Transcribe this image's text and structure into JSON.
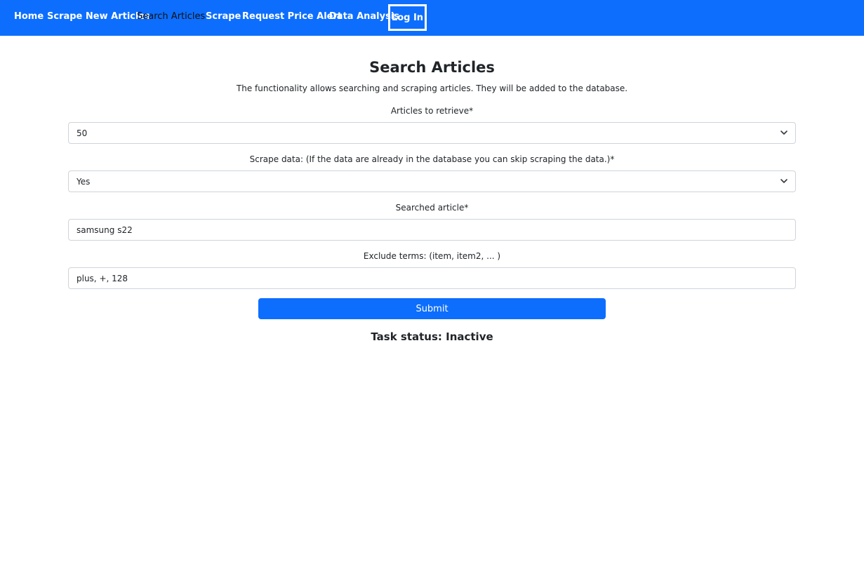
{
  "nav": {
    "items": [
      {
        "label": "Home"
      },
      {
        "label": "Scrape New Articles"
      },
      {
        "label": "Search Articles"
      },
      {
        "label": "Scrape"
      },
      {
        "label": "Request Price Alert"
      },
      {
        "label": "Data Analysis"
      }
    ],
    "login_label": "Log In"
  },
  "page": {
    "title": "Search Articles",
    "subtitle": "The functionality allows searching and scraping articles. They will be added to the database."
  },
  "form": {
    "articles_label": "Articles to retrieve*",
    "articles_value": "50",
    "scrape_label": "Scrape data: (If the data are already in the database you can skip scraping the data.)*",
    "scrape_value": "Yes",
    "searched_label": "Searched article*",
    "searched_value": "samsung s22",
    "exclude_label": "Exclude terms: (item, item2, ... )",
    "exclude_value": "plus, +, 128",
    "submit_label": "Submit"
  },
  "status": {
    "text": "Task status: Inactive"
  },
  "colors": {
    "brand": "#0d6efd"
  }
}
